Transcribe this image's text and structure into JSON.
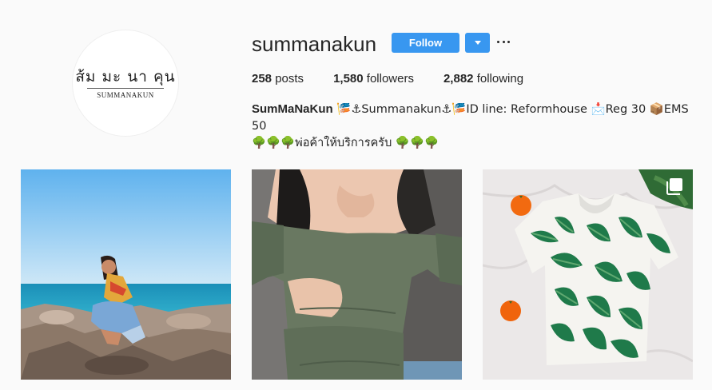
{
  "profile": {
    "avatar": {
      "thai_text": "ส้ม มะ นา คุน",
      "latin_text": "SUMMANAKUN"
    },
    "username": "summanakun",
    "follow_label": "Follow",
    "stats": {
      "posts_count": "258",
      "posts_label": "posts",
      "followers_count": "1,580",
      "followers_label": "followers",
      "following_count": "2,882",
      "following_label": "following"
    },
    "bio": {
      "name": "SumMaNaKun",
      "line1_rest": " 🎏⚓Summanakun⚓🎏ID line: Reformhouse 📩Reg 30 📦EMS 50",
      "line2": "🌳🌳🌳พ่อค้าให้บริการครับ 🌳🌳🌳"
    }
  },
  "posts": [
    {
      "name": "beach-rocks-photo",
      "multiple": false
    },
    {
      "name": "off-shoulder-top-photo",
      "multiple": false
    },
    {
      "name": "leaf-print-shirt-photo",
      "multiple": true
    }
  ],
  "icons": {
    "dropdown": "chevron-down-icon",
    "more": "more-options-icon",
    "multi": "carousel-icon"
  },
  "colors": {
    "accent": "#3897f0",
    "background": "#fafafa"
  }
}
